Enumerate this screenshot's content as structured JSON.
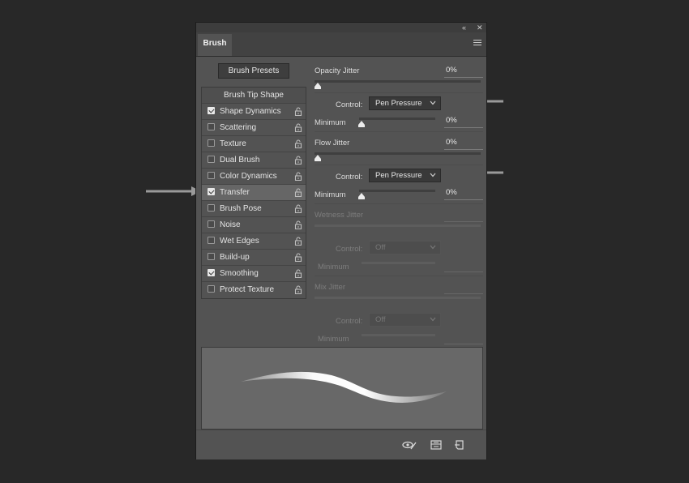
{
  "panel": {
    "tab_label": "Brush",
    "collapse_glyph": "«",
    "close_glyph": "✕",
    "menu_icon": "hamburger-menu-icon",
    "presets_button": "Brush Presets"
  },
  "options": [
    {
      "label": "Brush Tip Shape",
      "header": true
    },
    {
      "label": "Shape Dynamics",
      "checked": true
    },
    {
      "label": "Scattering",
      "checked": false
    },
    {
      "label": "Texture",
      "checked": false
    },
    {
      "label": "Dual Brush",
      "checked": false
    },
    {
      "label": "Color Dynamics",
      "checked": false
    },
    {
      "label": "Transfer",
      "checked": true,
      "selected": true
    },
    {
      "label": "Brush Pose",
      "checked": false
    },
    {
      "label": "Noise",
      "checked": false
    },
    {
      "label": "Wet Edges",
      "checked": false
    },
    {
      "label": "Build-up",
      "checked": false
    },
    {
      "label": "Smoothing",
      "checked": true
    },
    {
      "label": "Protect Texture",
      "checked": false
    }
  ],
  "transfer": {
    "opacity_jitter": {
      "label": "Opacity Jitter",
      "value": "0%",
      "control_label": "Control:",
      "control": "Pen Pressure",
      "minimum_label": "Minimum",
      "minimum": "0%"
    },
    "flow_jitter": {
      "label": "Flow Jitter",
      "value": "0%",
      "control_label": "Control:",
      "control": "Pen Pressure",
      "minimum_label": "Minimum",
      "minimum": "0%"
    },
    "wetness_jitter": {
      "label": "Wetness Jitter",
      "control_label": "Control:",
      "control": "Off",
      "minimum_label": "Minimum",
      "disabled": true
    },
    "mix_jitter": {
      "label": "Mix Jitter",
      "control_label": "Control:",
      "control": "Off",
      "minimum_label": "Minimum",
      "disabled": true
    }
  },
  "bottom_icons": [
    "toggle-live-tip-preview-icon",
    "brush-projection-icon",
    "new-brush-preset-icon"
  ]
}
